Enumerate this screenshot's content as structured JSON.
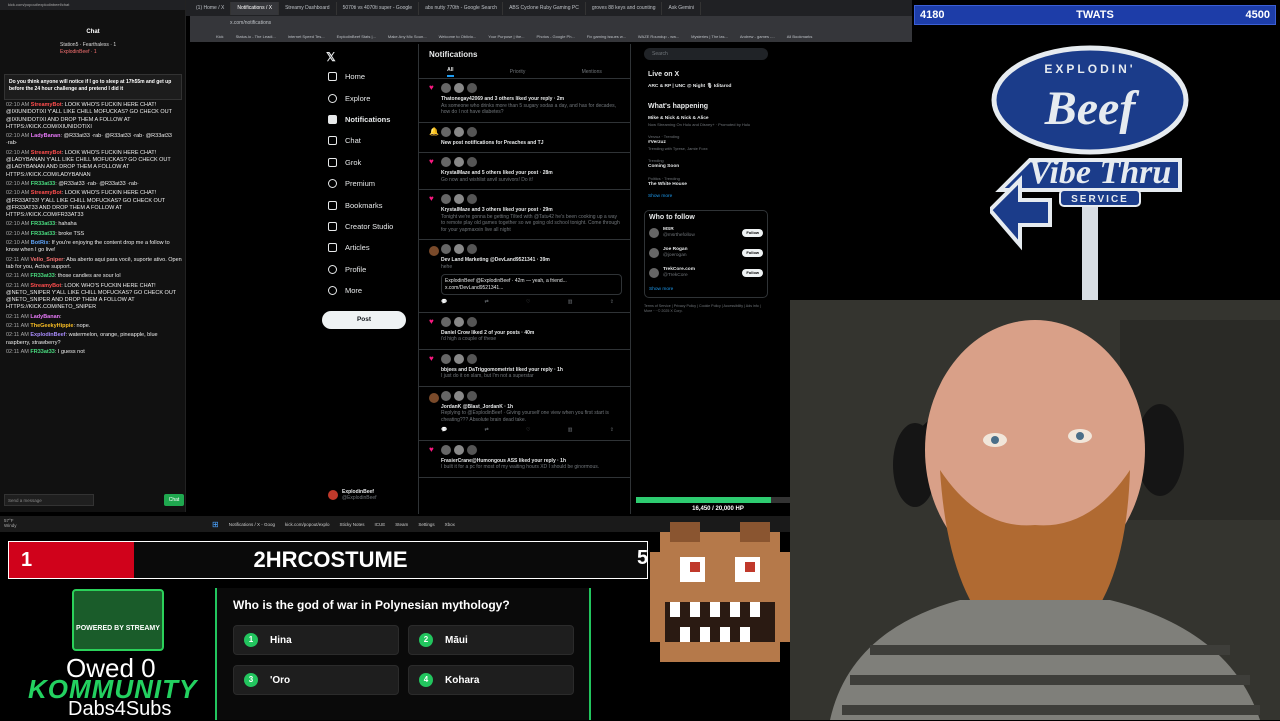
{
  "browser": {
    "tabs": [
      "(1) Home / X",
      "Notifications / X",
      "Streamy Dashboard",
      "5070ti vs 4070ti super - Google",
      "abs nutty 770th - Google Search",
      "ABS Cyclone Ruby Gaming PC",
      "groves 88 keys and counting",
      "Ask Gemini"
    ],
    "url": "x.com/notifications",
    "bookmarks": [
      "Kick",
      "Status.io - The Leadi...",
      "Internet Speed Tes...",
      "ExplodinBeef Stats |...",
      "Make Any Mic Soun...",
      "Welcome to Oblivio...",
      "Your Purpose | the...",
      "Photos - Google Ph...",
      "Fix gaming issues w...",
      "WAZE Roundup - ww...",
      "Mysteries | The las...",
      "Andrew - games -...",
      "All Bookmarks"
    ]
  },
  "chat": {
    "url": "kick.com/popout/explodinbeef/chat",
    "header": "Chat",
    "viewers": [
      "Station5 · Fearthaless · 1",
      "ExplodinBeef · 1"
    ],
    "pinned": "Do you think anyone will notice if I go to sleep at 17h55m and get up before the 24 hour challenge and pretend I did it",
    "messages": [
      {
        "time": "02:10 AM",
        "user": "StreamyBot",
        "color": "#ff4d4d",
        "text": "LOOK WHO'S FUCKIN HERE CHAT! @IXIUNIDOTIXI Y'ALL LIKE CHILL MOFUCKAS? GO CHECK OUT @IXIUNIDOTIXI AND DROP THEM A FOLLOW AT HTTPS://KICK.COM/IXIUNIDOTIXI"
      },
      {
        "time": "02:10 AM",
        "user": "LadyBanan",
        "color": "#e879f9",
        "text": "@R33at33 ·rab· @R33at33 ·rab· @R33at33 ·rab·"
      },
      {
        "time": "02:10 AM",
        "user": "StreamyBot",
        "color": "#ff4d4d",
        "text": "LOOK WHO'S FUCKIN HERE CHAT! @LADYBANAN Y'ALL LIKE CHILL MOFUCKAS? GO CHECK OUT @LADYBANAN AND DROP THEM A FOLLOW AT HTTPS://KICK.COM/LADYBANAN"
      },
      {
        "time": "02:10 AM",
        "user": "FR33at33",
        "color": "#4ade80",
        "text": "@R33at33 ·rab· @R33at33 ·rab·"
      },
      {
        "time": "02:10 AM",
        "user": "StreamyBot",
        "color": "#ff4d4d",
        "text": "LOOK WHO'S FUCKIN HERE CHAT! @FR33AT33! Y'ALL LIKE CHILL MOFUCKAS? GO CHECK OUT @FR33AT33 AND DROP THEM A FOLLOW AT HTTPS://KICK.COM/FR33AT33"
      },
      {
        "time": "02:10 AM",
        "user": "FR33at33",
        "color": "#4ade80",
        "text": "hahaha"
      },
      {
        "time": "02:10 AM",
        "user": "FR33at33",
        "color": "#4ade80",
        "text": "broke TSS"
      },
      {
        "time": "02:10 AM",
        "user": "BotRix",
        "color": "#60a5fa",
        "text": "If you're enjoying the content drop me a follow to know when I go live!"
      },
      {
        "time": "02:11 AM",
        "user": "Vello_Sniper",
        "color": "#f87171",
        "text": "Aba aberto aqui para você, suporte ativo. Open tab for you, Active support."
      },
      {
        "time": "02:11 AM",
        "user": "FR33at33",
        "color": "#4ade80",
        "text": "those candies are sour lol"
      },
      {
        "time": "02:11 AM",
        "user": "StreamyBot",
        "color": "#ff4d4d",
        "text": "LOOK WHO'S FUCKIN HERE CHAT! @NETO_SNIPER Y'ALL LIKE CHILL MOFUCKAS? GO CHECK OUT @NETO_SNIPER AND DROP THEM A FOLLOW AT HTTPS://KICK.COM/NETO_SNIPER"
      },
      {
        "time": "02:11 AM",
        "user": "LadyBanan",
        "color": "#e879f9",
        "text": ""
      },
      {
        "time": "02:11 AM",
        "user": "TheGeekyHippie",
        "color": "#fbbf24",
        "text": "nope."
      },
      {
        "time": "02:11 AM",
        "user": "ExplodinBeef",
        "color": "#a78bfa",
        "text": "watermelon, orange, pineapple, blue raspberry, strawberry?"
      },
      {
        "time": "02:11 AM",
        "user": "FR33at33",
        "color": "#4ade80",
        "text": "I guess not"
      }
    ],
    "input_placeholder": "Send a message",
    "send_label": "Chat"
  },
  "x": {
    "nav": [
      "Home",
      "Explore",
      "Notifications",
      "Chat",
      "Grok",
      "Premium",
      "Bookmarks",
      "Creator Studio",
      "Articles",
      "Profile",
      "More"
    ],
    "post_label": "Post",
    "profile_name": "ExplodinBeef",
    "profile_handle": "@ExplodinBeef",
    "feed_title": "Notifications",
    "feed_tabs": [
      "All",
      "Priority",
      "Mentions"
    ],
    "notifications": [
      {
        "icon": "♥",
        "color": "#f91880",
        "text": "Thatonegay42069 and 3 others liked your reply · 2m",
        "sub": "As someone who drinks more than 5 sugary sodas a day, and has for decades, how do I not have diabetes?"
      },
      {
        "icon": "🔔",
        "color": "#1d9bf0",
        "text": "New post notifications for Preaches and TJ",
        "sub": ""
      },
      {
        "icon": "♥",
        "color": "#f91880",
        "text": "KrystalMaze and 5 others liked your post · 28m",
        "sub": "Go now and wishlist anvil survivors! Do it!"
      },
      {
        "icon": "♥",
        "color": "#f91880",
        "text": "KrystalMaze and 3 others liked your post · 29m",
        "sub": "Tonight we're gonna be getting Tilted with @Tatu42 he's been cooking up a way to remote play old games together so we going old school tonight. Come through for your yapmaxxin live all night"
      },
      {
        "icon": "",
        "color": "#fff",
        "text": "Dev Land Marketing @DevLand9521341 · 39m",
        "sub": "hehe",
        "quote": "ExplodinBeef @ExplodinBeef · 42m — yeah, a friend... x.com/DevLand9521341...",
        "reply": true
      },
      {
        "icon": "♥",
        "color": "#f91880",
        "text": "Daniel Crow liked 2 of your posts · 40m",
        "sub": "i'd high a couple of these"
      },
      {
        "icon": "♥",
        "color": "#f91880",
        "text": "bbjees and DaTriggomometrist liked your reply · 1h",
        "sub": "I just do it on slam, but I'm not a superstar"
      },
      {
        "icon": "",
        "color": "#fff",
        "text": "JordanK @Blast_JordanK · 1h",
        "sub": "Replying to @ExplodinBeef · Giving yourself one view when you first start is cheating??? Absolute brain dead take.",
        "reply": true
      },
      {
        "icon": "♥",
        "color": "#f91880",
        "text": "FrasierCrane@Humongous ASS liked your reply · 1h",
        "sub": "I built it for a pc for most of my waiting hours XD I should be ginormous."
      }
    ],
    "search_placeholder": "Search",
    "live_title": "Live on X",
    "live_item": "ARC & RP | UNC @ Night 🎙 Iditarod",
    "happening_title": "What's happening",
    "trends": [
      {
        "cat": "",
        "name": "Mike & Nick & Nick & Alice",
        "desc": "Now Streaming On Hulu and Disney+ · Promoted by Hulu"
      },
      {
        "cat": "Verzuz · Trending",
        "name": "#Verzuz",
        "desc": "Trending with Tyrese, Jamie Foxx"
      },
      {
        "cat": "Trending",
        "name": "Coming Soon",
        "desc": ""
      },
      {
        "cat": "Politics · Trending",
        "name": "The White House",
        "desc": ""
      }
    ],
    "show_more": "Show more",
    "follow_title": "Who to follow",
    "follow": [
      {
        "name": "MSR",
        "handle": "@msrthefollow"
      },
      {
        "name": "Joe Rogan",
        "handle": "@joerogan"
      },
      {
        "name": "TrekCore.com",
        "handle": "@TrekCore"
      }
    ],
    "follow_label": "Follow",
    "footer": "Terms of Service | Privacy Policy | Cookie Policy | Accessibility | Ads info | More ··· © 2025 X Corp."
  },
  "taskbar": {
    "weather_temp": "57°F",
    "weather_desc": "Windy",
    "items": [
      "Notifications / X - Goog",
      "kick.com/popout/explo",
      "Sticky Notes",
      "ICUE",
      "Steam",
      "Settings",
      "Xbox"
    ],
    "time": "2:11 AM",
    "date": "3/27/2026"
  },
  "hp": {
    "text": "16,450 / 20,000 HP",
    "fraction": 0.8225
  },
  "scorebar": {
    "left": "4180",
    "center": "TWATS",
    "right": "4500"
  },
  "sign": {
    "line1": "EXPLODIN'",
    "line2": "Beef",
    "line3": "Vibe Thru",
    "line4": "SERVICE"
  },
  "counter": {
    "count": "1",
    "goal": "2HRCOSTUME",
    "edge": "5"
  },
  "streamy": {
    "text": "POWERED BY STREAMY"
  },
  "owed": "Owed 0",
  "kommunity": "KOMMUNITY",
  "dabs": "Dabs4Subs",
  "trivia": {
    "question": "Who is the god of war in Polynesian mythology?",
    "answers": [
      {
        "num": "1",
        "text": "Hina"
      },
      {
        "num": "2",
        "text": "Māui"
      },
      {
        "num": "3",
        "text": "'Oro"
      },
      {
        "num": "4",
        "text": "Kohara"
      }
    ]
  }
}
